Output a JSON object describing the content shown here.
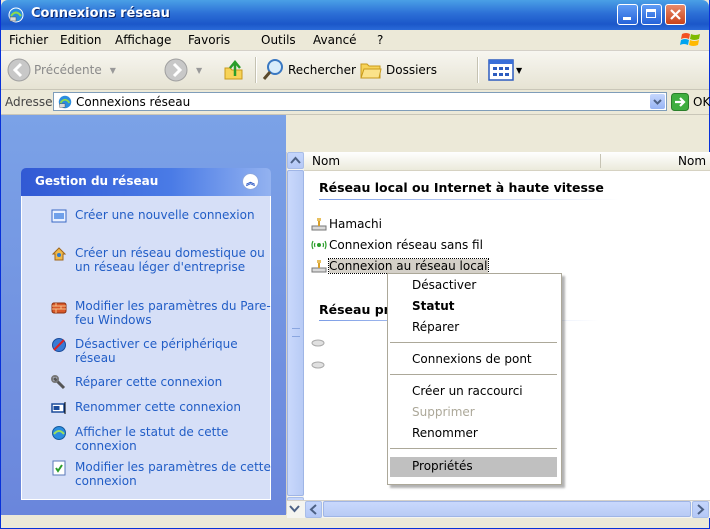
{
  "window": {
    "title": "Connexions réseau"
  },
  "menu": [
    "Fichier",
    "Edition",
    "Affichage",
    "Favoris",
    "Outils",
    "Avancé",
    "?"
  ],
  "toolbar": {
    "back_label": "Précédente",
    "search_label": "Rechercher",
    "folders_label": "Dossiers"
  },
  "address": {
    "label": "Adresse",
    "value": "Connexions réseau",
    "go_label": "OK"
  },
  "tasks": {
    "title": "Gestion du réseau",
    "items": [
      "Créer une nouvelle connexion",
      "Créer un réseau domestique ou un réseau léger d'entreprise",
      "Modifier les paramètres du Pare-feu Windows",
      "Désactiver ce périphérique réseau",
      "Réparer cette connexion",
      "Renommer cette connexion",
      "Afficher le statut de cette connexion",
      "Modifier les paramètres de cette connexion"
    ]
  },
  "columns": {
    "name": "Nom",
    "name2": "Nom"
  },
  "groups": {
    "lan_title": "Réseau local ou Internet à haute vitesse",
    "vpn_title": "Réseau pr"
  },
  "connections": [
    {
      "label": "Hamachi",
      "icon": "lan-icon"
    },
    {
      "label": "Connexion réseau sans fil",
      "icon": "wireless-icon"
    },
    {
      "label": "Connexion au réseau local",
      "icon": "lan-icon",
      "selected": true
    }
  ],
  "context_menu": {
    "items": [
      {
        "label": "Désactiver"
      },
      {
        "label": "Statut",
        "bold": true
      },
      {
        "label": "Réparer"
      },
      {
        "label": "Connexions de pont"
      },
      {
        "label": "Créer un raccourci"
      },
      {
        "label": "Supprimer",
        "disabled": true
      },
      {
        "label": "Renommer"
      },
      {
        "label": "Propriétés",
        "highlighted": true
      }
    ]
  },
  "colors": {
    "titlebar": "#1b57c9",
    "task_link": "#215dc6",
    "task_pane": "#6a86dc"
  }
}
